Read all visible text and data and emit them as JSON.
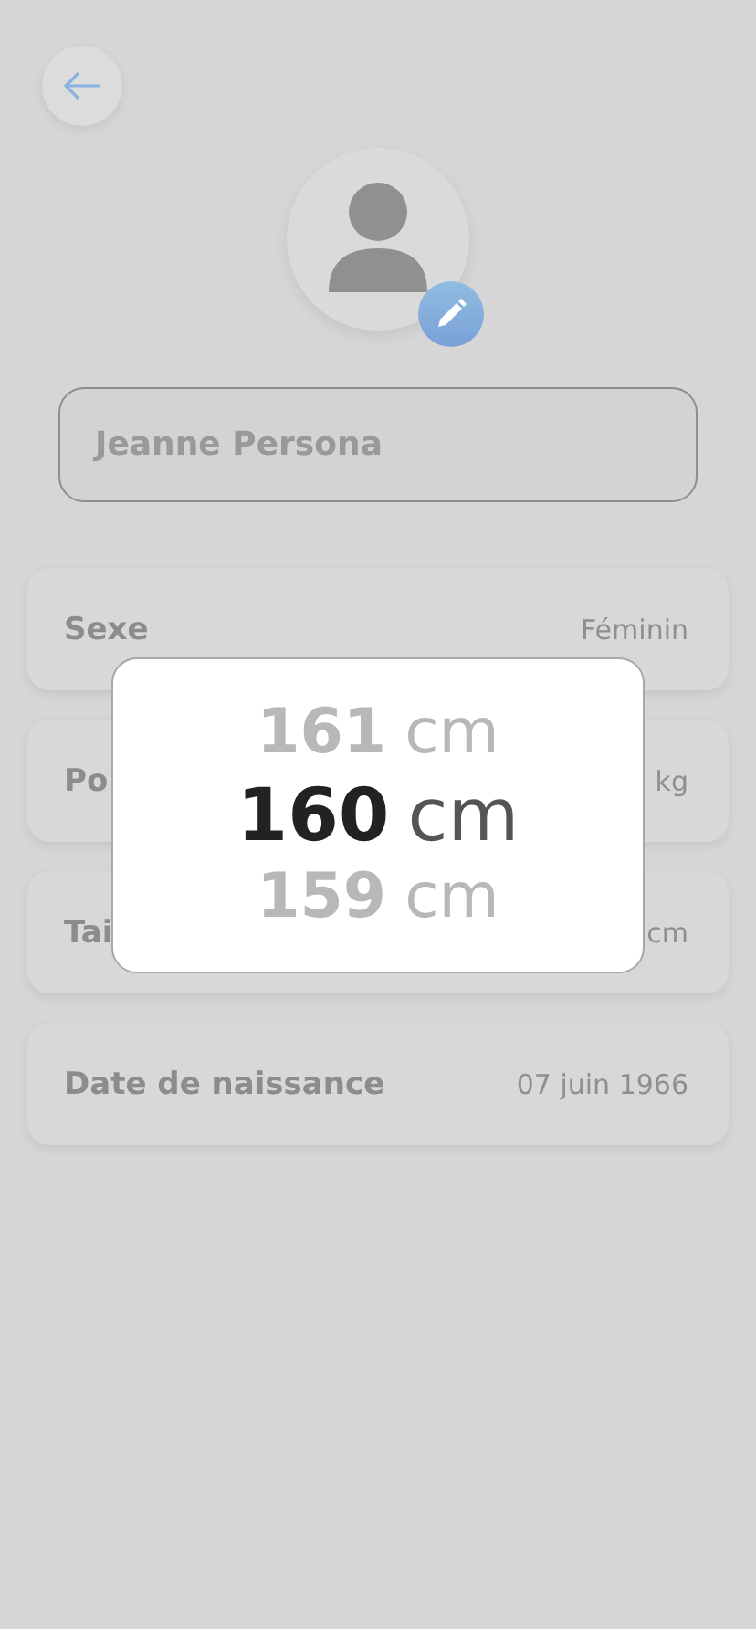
{
  "name_field": {
    "value": "Jeanne Persona"
  },
  "fields": [
    {
      "label": "Sexe",
      "value": "Féminin"
    },
    {
      "label": "Po",
      "value": "kg"
    },
    {
      "label": "Tai",
      "value": "cm"
    },
    {
      "label": "Date de naissance",
      "value": "07 juin 1966"
    }
  ],
  "picker": {
    "options": [
      {
        "number": "161",
        "unit": "cm",
        "selected": false
      },
      {
        "number": "160",
        "unit": "cm",
        "selected": true
      },
      {
        "number": "159",
        "unit": "cm",
        "selected": false
      }
    ]
  }
}
